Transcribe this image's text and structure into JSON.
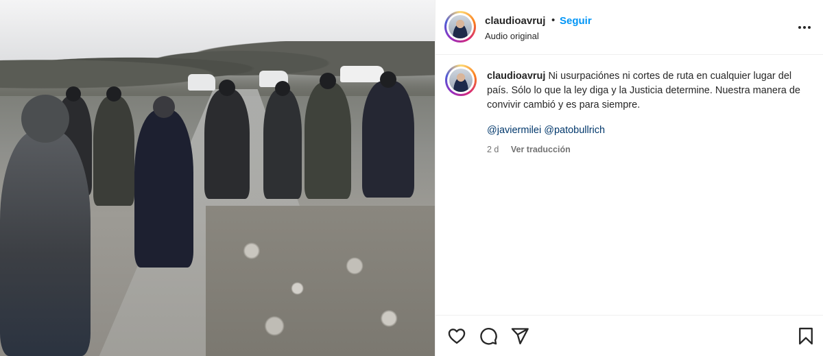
{
  "post": {
    "username": "claudioavruj",
    "separator": "•",
    "follow_label": "Seguir",
    "audio_label": "Audio original",
    "more_icon": "more-horizontal-icon"
  },
  "caption": {
    "username": "claudioavruj",
    "text": "Ni usurpaciónes ni cortes de ruta en cualquier lugar del país. Sólo lo que la ley diga y la Justicia determine. Nuestra manera de convivir cambió y es para siempre.",
    "mention_1": "@javiermilei",
    "mention_2": "@patobullrich",
    "time": "2 d",
    "translate_label": "Ver traducción"
  },
  "actions": {
    "like_icon": "heart-icon",
    "comment_icon": "comment-icon",
    "share_icon": "send-icon",
    "save_icon": "bookmark-icon"
  },
  "colors": {
    "accent": "#0095f6",
    "mention": "#00376b",
    "muted": "#737373",
    "border": "#efefef"
  }
}
